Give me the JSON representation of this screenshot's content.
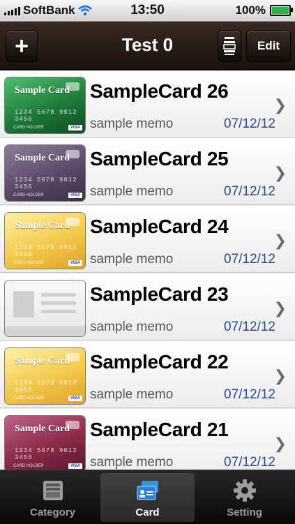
{
  "statusbar": {
    "carrier": "SoftBank",
    "time": "13:50",
    "battery": "100%"
  },
  "navbar": {
    "add_label": "+",
    "title": "Test 0",
    "edit_label": "Edit"
  },
  "cards": [
    {
      "name": "SampleCard 26",
      "memo": "sample memo",
      "date": "07/12/12",
      "style": "green",
      "card_title": "Sample Card",
      "card_number": "1234 5678 9012 3456",
      "holder": "CARD HOLDER",
      "brand": "VISA"
    },
    {
      "name": "SampleCard 25",
      "memo": "sample memo",
      "date": "07/12/12",
      "style": "purple",
      "card_title": "Sample Card",
      "card_number": "1234 5678 9012 3456",
      "holder": "CARD HOLDER",
      "brand": "VISA"
    },
    {
      "name": "SampleCard 24",
      "memo": "sample memo",
      "date": "07/12/12",
      "style": "gold",
      "card_title": "Sample Card",
      "card_number": "1234 5678 9012 3456",
      "holder": "CARD HOLDER",
      "brand": "VISA"
    },
    {
      "name": "SampleCard 23",
      "memo": "sample memo",
      "date": "07/12/12",
      "style": "generic",
      "card_title": "",
      "card_number": "",
      "holder": "",
      "brand": ""
    },
    {
      "name": "SampleCard 22",
      "memo": "sample memo",
      "date": "07/12/12",
      "style": "gold",
      "card_title": "Sample Card",
      "card_number": "1234 5678 9012 3456",
      "holder": "CARD HOLDER",
      "brand": "VISA"
    },
    {
      "name": "SampleCard 21",
      "memo": "sample memo",
      "date": "07/12/12",
      "style": "rose",
      "card_title": "Sample Card",
      "card_number": "1234 5678 9012 3456",
      "holder": "CARD HOLDER",
      "brand": "VISA"
    }
  ],
  "card_styles": {
    "green": "#1f7a3c",
    "purple": "#5b4a68",
    "gold": "#f2c94c",
    "rose": "#8a2a47"
  },
  "tabs": [
    {
      "label": "Category",
      "icon": "category-tray-icon",
      "active": false
    },
    {
      "label": "Card",
      "icon": "cards-icon",
      "active": true
    },
    {
      "label": "Setting",
      "icon": "gear-icon",
      "active": false
    }
  ]
}
